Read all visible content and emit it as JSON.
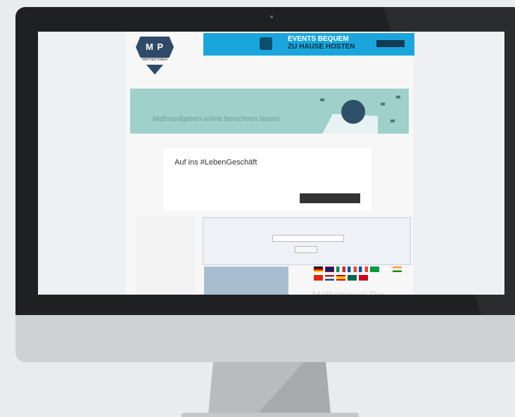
{
  "site": {
    "logo": {
      "letters": "M P",
      "subtitle": "MATHEPOWER"
    },
    "ad": {
      "brand": "",
      "title_line1": "EVENTS BEQUEM",
      "title_line2": "ZU HAUSE HOSTEN",
      "button": ""
    },
    "hero": {
      "text": "Matheaufgaben online berechnen lassen"
    },
    "corner_label": "",
    "consent": {
      "title": "Auf ins #LebenGeschäft",
      "description": "",
      "left_text": "",
      "button": ""
    },
    "sidebar": {
      "title": "",
      "items": [
        {
          "label": "",
          "active": true
        },
        {
          "label": ""
        },
        {
          "label": ""
        },
        {
          "label": ""
        },
        {
          "label": ""
        }
      ]
    },
    "search": {
      "title": "",
      "input_value": "",
      "button": ""
    },
    "promo": {
      "text": ""
    },
    "flags": {
      "colors": [
        "#000000",
        "#cccccc",
        "#009246",
        "#0055a4",
        "#ff9933",
        "#009c3b",
        "#c8102e",
        "#ae1c28",
        "#ffc400",
        "#006847",
        "#c60b1e"
      ]
    },
    "heading_partial": "Mathepower Der"
  },
  "colors": {
    "hero_bg": "#9fd0c9",
    "ad_bg": "#1aa6dc",
    "accent_link": "#d44b2c"
  }
}
